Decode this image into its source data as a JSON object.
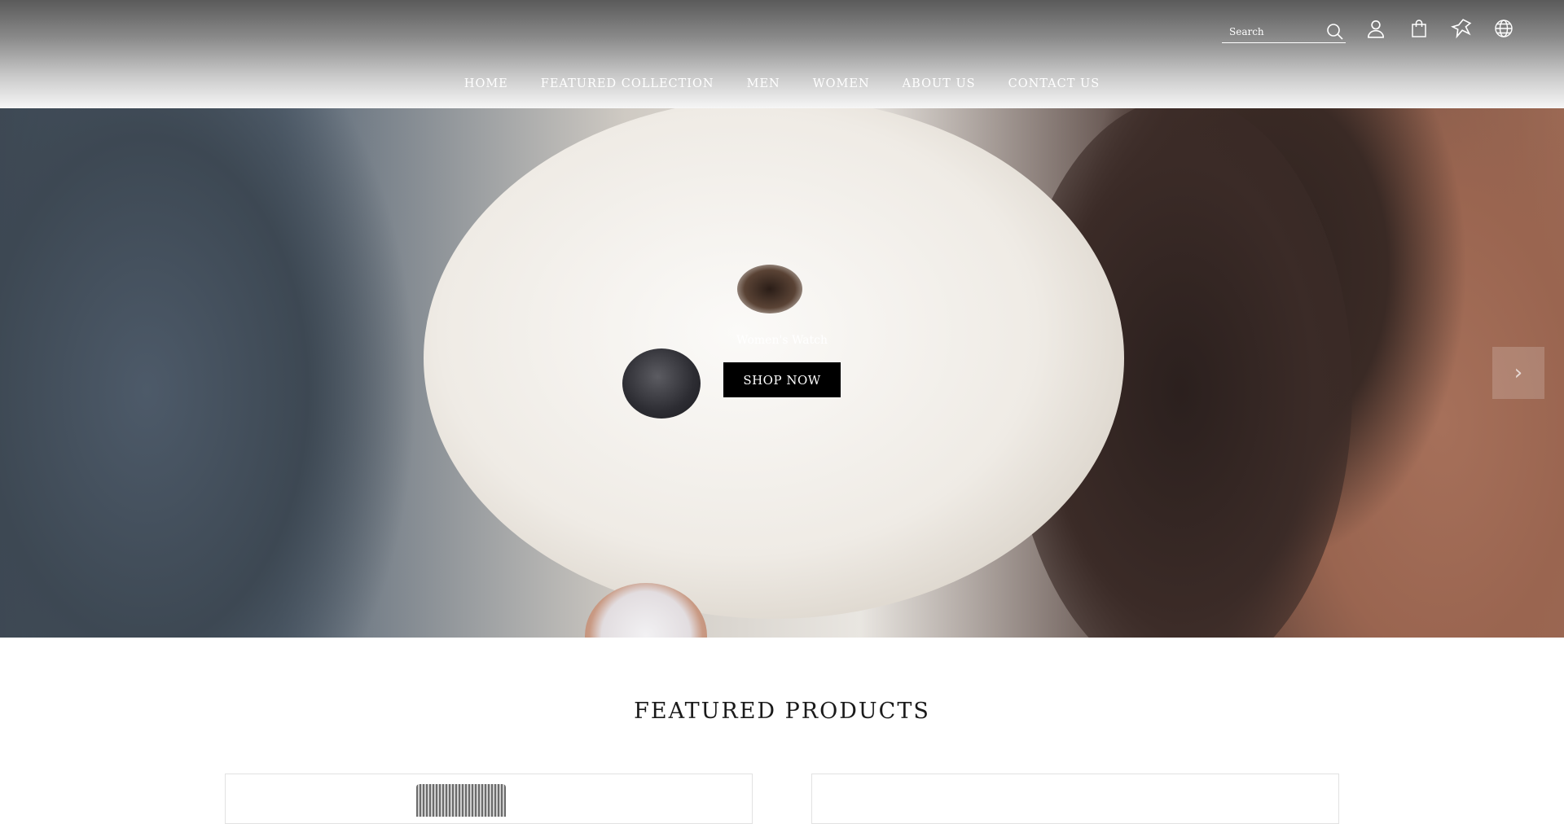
{
  "header": {
    "search": {
      "placeholder": "Search"
    },
    "icons": [
      "search-icon",
      "account-icon",
      "cart-icon",
      "wishlist-icon",
      "globe-icon"
    ]
  },
  "nav": {
    "items": [
      {
        "label": "HOME"
      },
      {
        "label": "FEATURED COLLECTION"
      },
      {
        "label": "MEN"
      },
      {
        "label": "WOMEN"
      },
      {
        "label": "ABOUT US"
      },
      {
        "label": "CONTACT US"
      }
    ]
  },
  "hero": {
    "subtitle": "Women's Watch",
    "cta_label": "SHOP NOW",
    "next_icon": "chevron-right-icon"
  },
  "featured": {
    "title": "FEATURED PRODUCTS"
  },
  "colors": {
    "cta_background": "#000000",
    "cta_text": "#ffffff",
    "nav_text": "#ffffff",
    "title_text": "#1a1a1a"
  }
}
